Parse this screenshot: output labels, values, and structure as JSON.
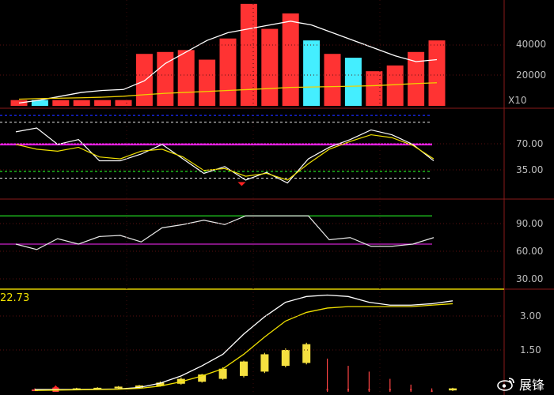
{
  "volume_panel": {
    "axis_labels": [
      "40000",
      "20000"
    ],
    "unit_label": "X10"
  },
  "oscillator_panel": {
    "axis_labels": [
      "70.00",
      "35.00"
    ]
  },
  "rsi_panel": {
    "axis_labels": [
      "90.00",
      "60.00",
      "30.00"
    ]
  },
  "main_panel": {
    "value_label": "22.73",
    "axis_labels": [
      "3.00",
      "1.50"
    ]
  },
  "watermark": {
    "text": "展锋"
  },
  "chart_data": [
    {
      "type": "bar",
      "title": "",
      "ylim": [
        0,
        55000
      ],
      "series": [
        {
          "name": "",
          "values": [
            3000,
            3000,
            3000,
            3000,
            3000,
            3000,
            27000,
            28000,
            29000,
            24000,
            35000,
            53000,
            40000,
            48000,
            34000,
            27000,
            25000,
            18000,
            21000,
            28000,
            34000
          ]
        },
        {
          "name": "",
          "values": [
            1500,
            3000,
            5000,
            7000,
            8000,
            8500,
            13000,
            22000,
            28000,
            34000,
            38000,
            40000,
            42000,
            44000,
            42000,
            38000,
            34000,
            30000,
            26000,
            23000,
            24000
          ]
        },
        {
          "name": "",
          "values": [
            3500,
            3800,
            4000,
            4200,
            4500,
            5000,
            5800,
            6500,
            7000,
            7500,
            8000,
            8500,
            9000,
            9600,
            9800,
            10000,
            10200,
            10500,
            11000,
            11600,
            12000
          ]
        }
      ],
      "colors": {
        "up": "#ff3333",
        "down": "#44eeff",
        "ma_fast": "#ffffff",
        "ma_slow": "#f0d000"
      }
    },
    {
      "type": "line",
      "ylim": [
        0,
        90
      ],
      "series": [
        {
          "name": "",
          "values": [
            68,
            72,
            55,
            60,
            38,
            38,
            45,
            55,
            40,
            25,
            32,
            18,
            26,
            15,
            40,
            52,
            60,
            70,
            65,
            55,
            38
          ]
        },
        {
          "name": "",
          "values": [
            55,
            50,
            48,
            52,
            42,
            40,
            48,
            50,
            42,
            28,
            30,
            22,
            25,
            18,
            35,
            50,
            58,
            65,
            62,
            54,
            40
          ]
        }
      ],
      "reference_lines": [
        {
          "value": 85,
          "color": "#1a2aff",
          "dash": true
        },
        {
          "value": 78,
          "color": "#d0d0d0",
          "dash": true
        },
        {
          "value": 55,
          "color": "#ff22ff",
          "dash": false
        },
        {
          "value": 27,
          "color": "#22dd22",
          "dash": true
        },
        {
          "value": 20,
          "color": "#d0d0d0",
          "dash": true
        }
      ]
    },
    {
      "type": "line",
      "ylim": [
        20,
        100
      ],
      "series": [
        {
          "name": "",
          "values": [
            60,
            55,
            65,
            60,
            67,
            68,
            62,
            75,
            78,
            82,
            78,
            86,
            86,
            86,
            86,
            64,
            66,
            58,
            58,
            60,
            66
          ]
        }
      ],
      "reference_lines": [
        {
          "value": 86,
          "color": "#22dd22",
          "dash": false
        },
        {
          "value": 60,
          "color": "#cc22cc",
          "dash": false
        }
      ]
    },
    {
      "type": "line",
      "ylim": [
        0,
        3.5
      ],
      "series": [
        {
          "name": "",
          "values": [
            0.08,
            0.08,
            0.08,
            0.09,
            0.1,
            0.15,
            0.3,
            0.55,
            0.9,
            1.3,
            2.0,
            2.6,
            3.1,
            3.3,
            3.35,
            3.3,
            3.1,
            3.0,
            3.0,
            3.05,
            3.15
          ]
        },
        {
          "name": "",
          "values": [
            0.05,
            0.06,
            0.07,
            0.08,
            0.09,
            0.12,
            0.2,
            0.35,
            0.55,
            0.8,
            1.3,
            1.9,
            2.45,
            2.75,
            2.9,
            2.95,
            2.95,
            2.95,
            2.95,
            3.0,
            3.05
          ]
        }
      ],
      "candles": [
        {
          "open": 0.05,
          "close": 0.08,
          "high": 0.12,
          "low": 0.05,
          "color": "#ff4444"
        },
        {
          "open": 0.0,
          "close": 0.15,
          "high": 0.22,
          "low": 0.0,
          "color": "#ff4444"
        },
        {
          "open": 0.08,
          "close": 0.12,
          "high": 0.14,
          "low": 0.06,
          "color": "#f5e040"
        },
        {
          "open": 0.1,
          "close": 0.14,
          "high": 0.16,
          "low": 0.08,
          "color": "#f5e040"
        },
        {
          "open": 0.12,
          "close": 0.18,
          "high": 0.2,
          "low": 0.1,
          "color": "#f5e040"
        },
        {
          "open": 0.15,
          "close": 0.22,
          "high": 0.24,
          "low": 0.12,
          "color": "#f5e040"
        },
        {
          "open": 0.2,
          "close": 0.32,
          "high": 0.36,
          "low": 0.18,
          "color": "#f5e040"
        },
        {
          "open": 0.28,
          "close": 0.45,
          "high": 0.5,
          "low": 0.25,
          "color": "#f5e040"
        },
        {
          "open": 0.35,
          "close": 0.6,
          "high": 0.62,
          "low": 0.32,
          "color": "#f5e040"
        },
        {
          "open": 0.45,
          "close": 0.8,
          "high": 0.85,
          "low": 0.42,
          "color": "#f5e040"
        },
        {
          "open": 0.55,
          "close": 1.05,
          "high": 1.08,
          "low": 0.5,
          "color": "#f5e040"
        },
        {
          "open": 0.7,
          "close": 1.3,
          "high": 1.35,
          "low": 0.65,
          "color": "#f5e040"
        },
        {
          "open": 0.9,
          "close": 1.45,
          "high": 1.5,
          "low": 0.85,
          "color": "#f5e040"
        },
        {
          "open": 1.0,
          "close": 1.65,
          "high": 1.7,
          "low": 0.95,
          "color": "#f5e040"
        },
        {
          "open": 0.1,
          "close": 0.1,
          "high": 1.15,
          "low": 0.0,
          "color": "#ff4444"
        },
        {
          "open": 0.1,
          "close": 0.1,
          "high": 0.9,
          "low": 0.0,
          "color": "#ff4444"
        },
        {
          "open": 0.1,
          "close": 0.1,
          "high": 0.7,
          "low": 0.0,
          "color": "#ff4444"
        },
        {
          "open": 0.1,
          "close": 0.1,
          "high": 0.45,
          "low": 0.0,
          "color": "#ff4444"
        },
        {
          "open": 0.1,
          "close": 0.1,
          "high": 0.25,
          "low": 0.0,
          "color": "#ff4444"
        },
        {
          "open": 0.05,
          "close": 0.05,
          "high": 0.12,
          "low": 0.0,
          "color": "#ff4444"
        },
        {
          "open": 0.05,
          "close": 0.12,
          "high": 0.14,
          "low": 0.03,
          "color": "#f5e040"
        }
      ]
    }
  ]
}
